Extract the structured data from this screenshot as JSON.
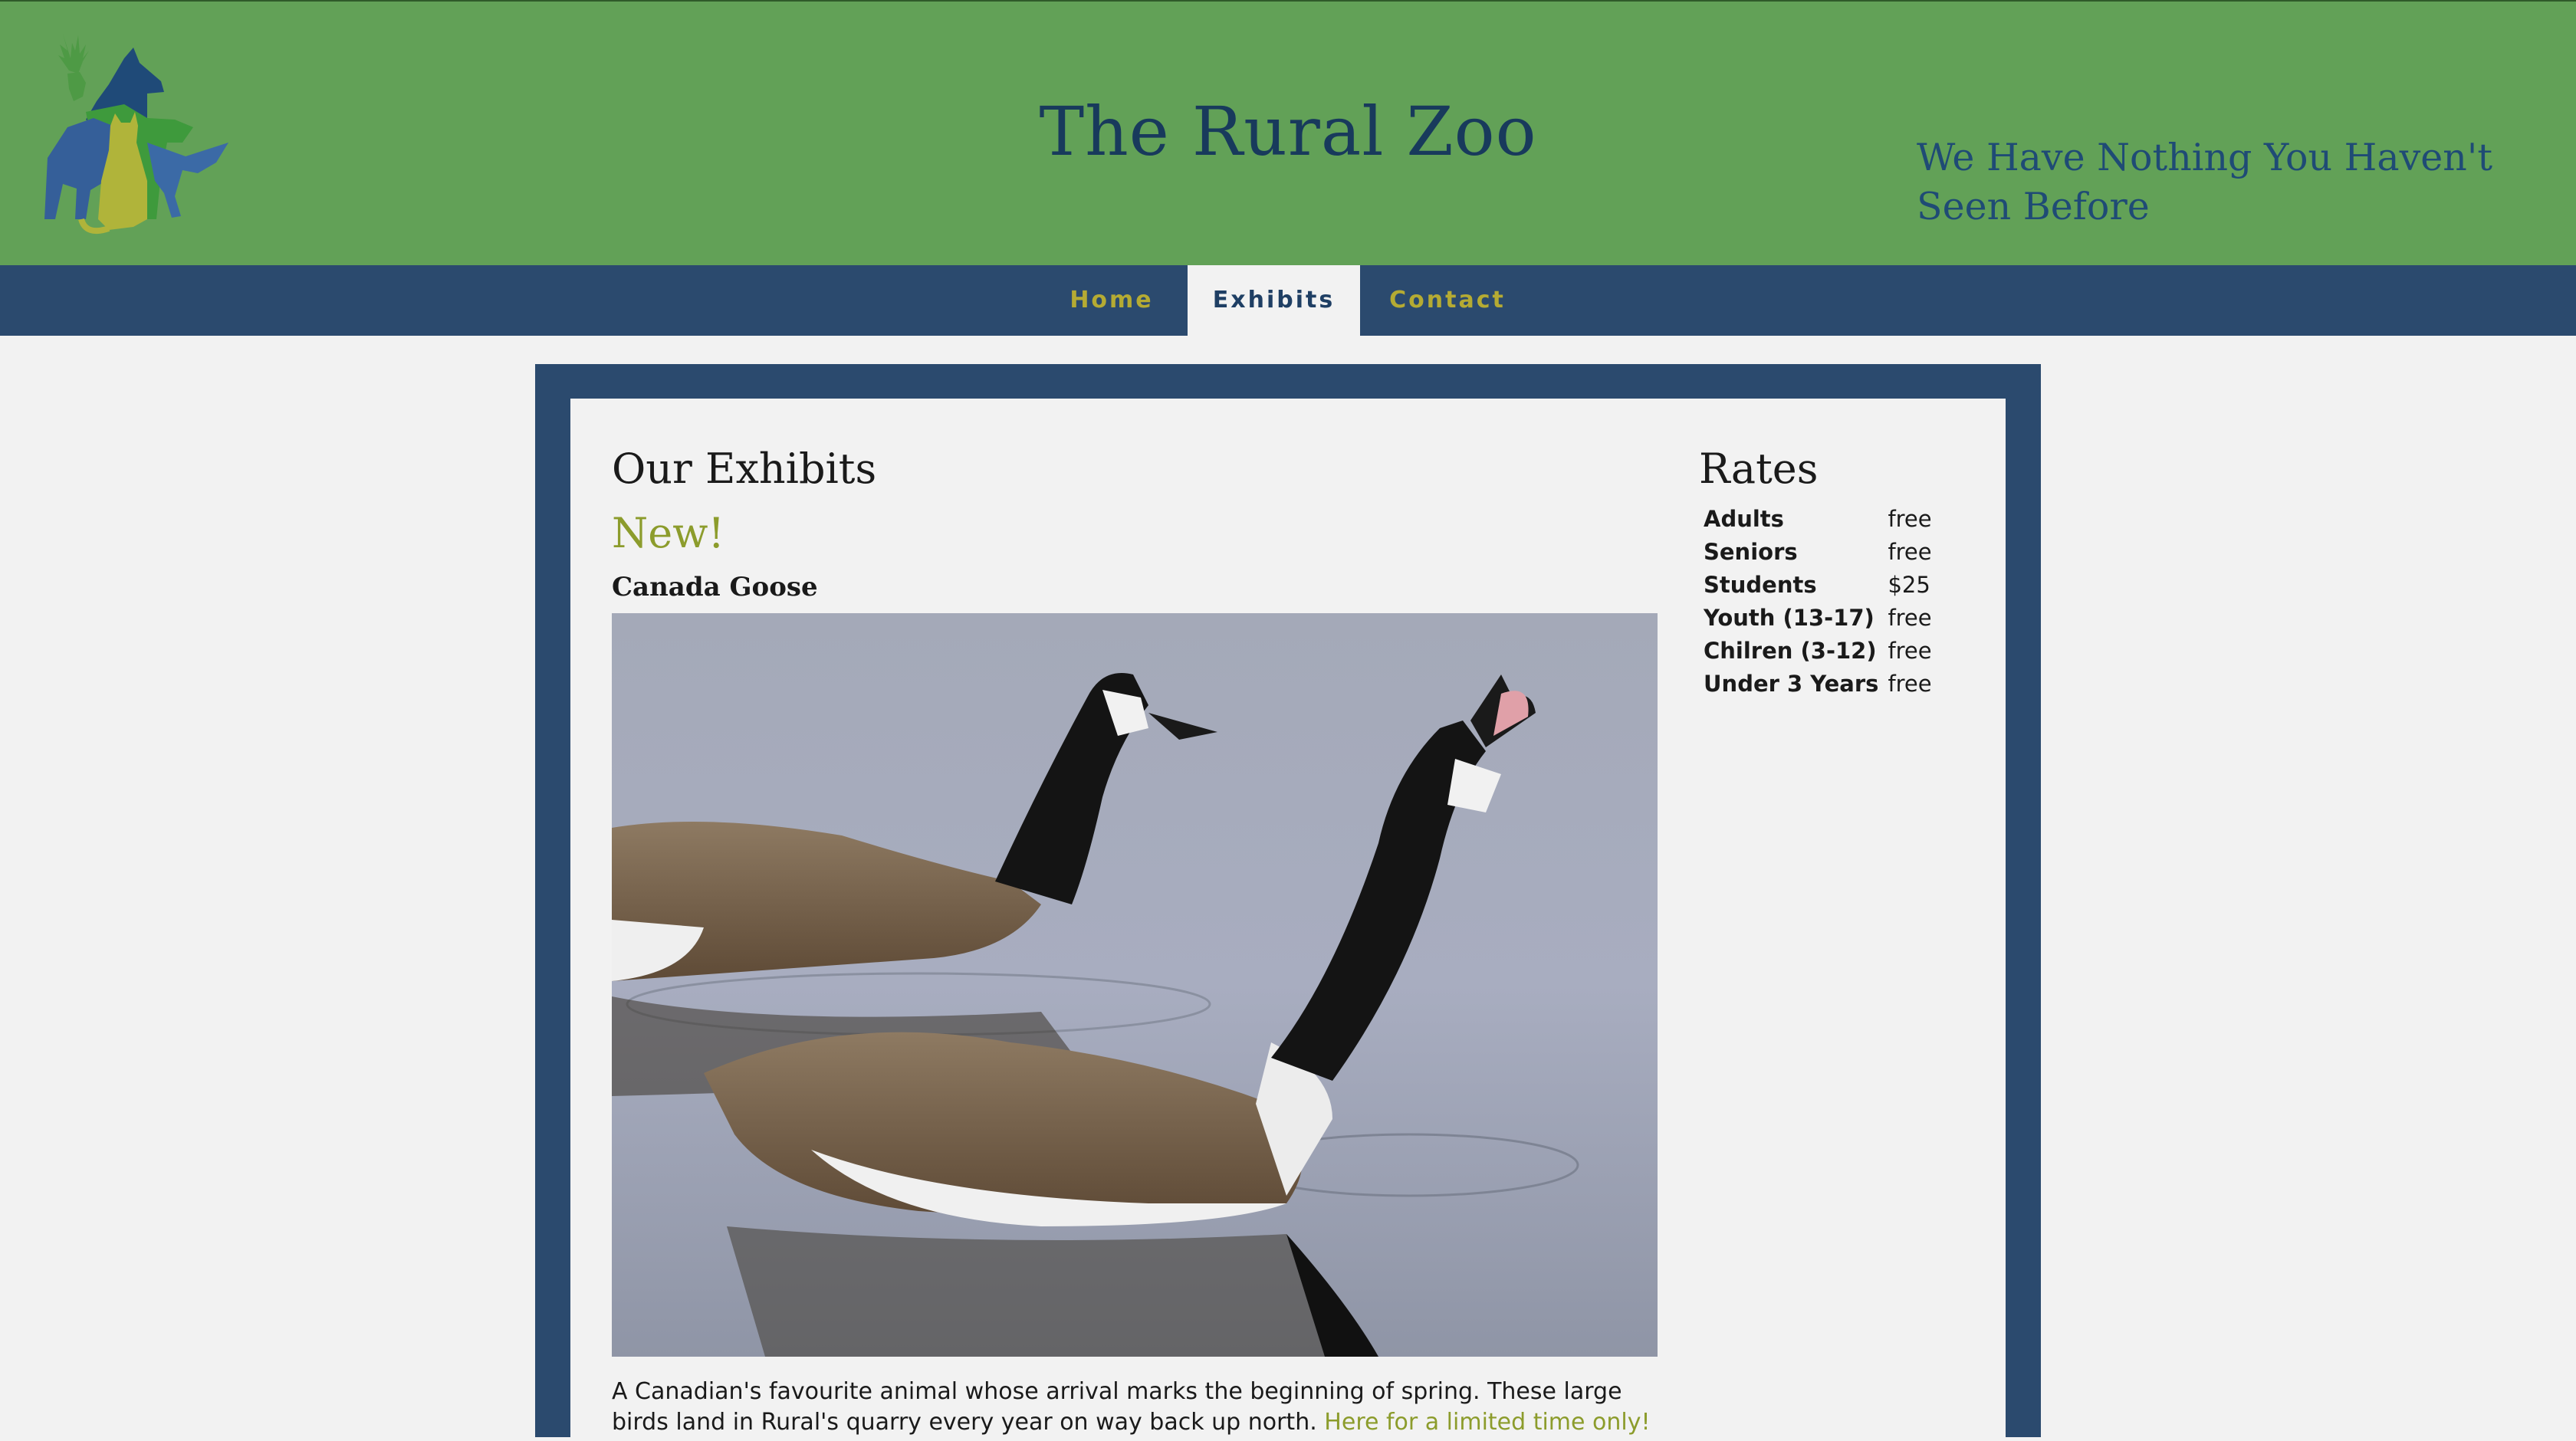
{
  "header": {
    "logo_name": "animal-silhouettes-logo",
    "title": "The Rural Zoo",
    "tagline": "We Have Nothing You Haven't Seen Before"
  },
  "nav": {
    "items": [
      {
        "label": "Home",
        "active": false
      },
      {
        "label": "Exhibits",
        "active": true
      },
      {
        "label": "Contact",
        "active": false
      }
    ]
  },
  "main": {
    "heading": "Our Exhibits",
    "new_label": "New!",
    "exhibit": {
      "name": "Canada Goose",
      "description": "A Canadian's favourite animal whose arrival marks the beginning of spring. These large birds land in Rural's quarry every year on way back up north. ",
      "link": "Here for a limited time only!"
    }
  },
  "rates": {
    "heading": "Rates",
    "rows": [
      {
        "label": "Adults",
        "price": "free"
      },
      {
        "label": "Seniors",
        "price": "free"
      },
      {
        "label": "Students",
        "price": "$25"
      },
      {
        "label": "Youth (13-17)",
        "price": "free"
      },
      {
        "label": "Chilren (3-12)",
        "price": "free"
      },
      {
        "label": "Under 3 Years",
        "price": "free"
      }
    ]
  },
  "colors": {
    "header_green": "#62a157",
    "nav_blue": "#2b4a6e",
    "title_navy": "#183a5c",
    "accent_olive": "#8c9c2c",
    "page_bg": "#f2f2f2"
  }
}
